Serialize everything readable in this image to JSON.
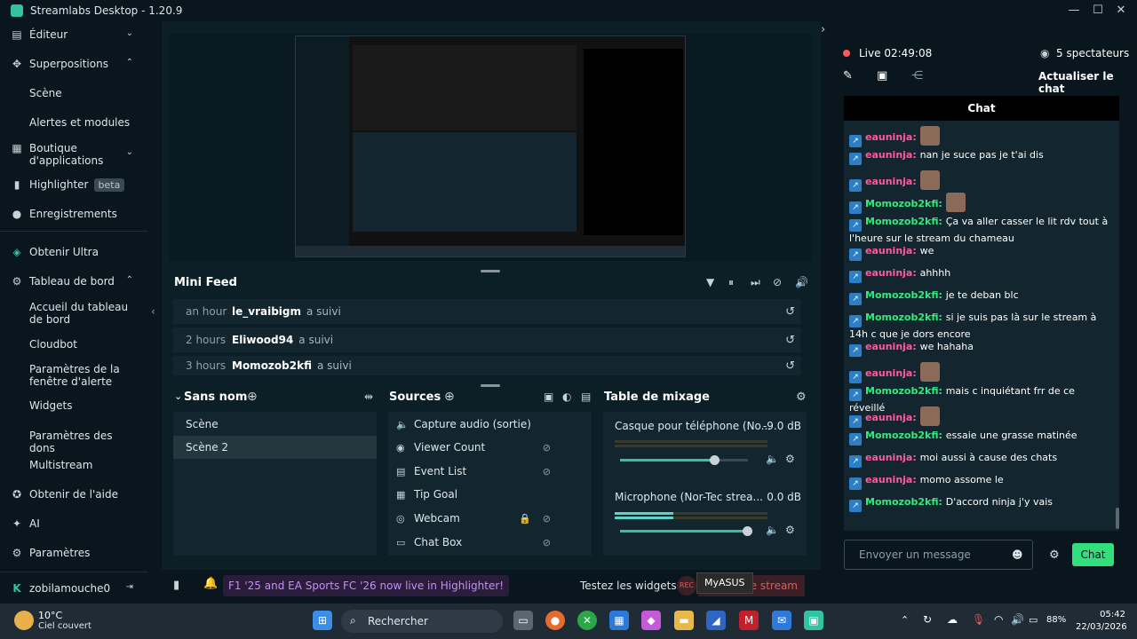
{
  "window": {
    "title": "Streamlabs Desktop - 1.20.9",
    "accent": "#31c3a2"
  },
  "sidebar": {
    "editor": "Éditeur",
    "overlays": "Superpositions",
    "overlays_sub": [
      "Scène",
      "Alertes et modules"
    ],
    "app_store": "Boutique d'applications",
    "highlighter": "Highlighter",
    "highlighter_badge": "beta",
    "recordings": "Enregistrements",
    "ultra": "Obtenir Ultra",
    "dashboard": "Tableau de bord",
    "dashboard_sub": [
      "Accueil du tableau de bord",
      "Cloudbot",
      "Paramètres de la fenêtre d'alerte",
      "Widgets",
      "Paramètres des dons",
      "Multistream"
    ],
    "help": "Obtenir de l'aide",
    "ai": "AI",
    "settings": "Paramètres",
    "user": "zobilamouche0"
  },
  "minifeed": {
    "title": "Mini Feed",
    "rows": [
      {
        "time": "an hour",
        "name": "le_vraibigm",
        "action": "a suivi"
      },
      {
        "time": "2 hours",
        "name": "Eliwood94",
        "action": "a suivi"
      },
      {
        "time": "3 hours",
        "name": "Momozob2kfi",
        "action": "a suivi"
      }
    ]
  },
  "scenes": {
    "title": "Sans nom",
    "items": [
      "Scène",
      "Scène 2"
    ]
  },
  "sources": {
    "title": "Sources",
    "items": [
      {
        "label": "Capture audio (sortie)",
        "icon": "speaker-icon"
      },
      {
        "label": "Viewer Count",
        "icon": "eye-icon"
      },
      {
        "label": "Event List",
        "icon": "list-icon"
      },
      {
        "label": "Tip Goal",
        "icon": "calendar-icon"
      },
      {
        "label": "Webcam",
        "icon": "webcam-icon"
      },
      {
        "label": "Chat Box",
        "icon": "chat-icon"
      }
    ]
  },
  "mixer": {
    "title": "Table de mixage",
    "channels": [
      {
        "label": "Casque pour téléphone (No...",
        "db": "-9.0 dB",
        "level": 0.74
      },
      {
        "label": "Microphone (Nor-Tec strea...",
        "db": "0.0 dB",
        "level": 1.0
      }
    ]
  },
  "bottombar": {
    "promo": "F1 '25 and EA Sports FC '26 now live in Highlighter!",
    "test_widgets": "Testez les widgets",
    "tooltip": "MyASUS",
    "end_stream": "r le stream"
  },
  "live": {
    "status": "Live",
    "time": "02:49:08",
    "viewers": "5 spectateurs",
    "refresh": "Actualiser le chat"
  },
  "chat": {
    "title": "Chat",
    "input_placeholder": "Envoyer un message",
    "send": "Chat",
    "messages": [
      {
        "user": "eauninja",
        "text": "",
        "emote": true,
        "type": "u1"
      },
      {
        "user": "eauninja",
        "text": "nan je suce pas je t'ai dis",
        "emote": false,
        "type": "u1"
      },
      {
        "user": "eauninja",
        "text": "",
        "emote": true,
        "type": "u1"
      },
      {
        "user": "Momozob2kfi",
        "text": "",
        "emote": true,
        "type": "u2"
      },
      {
        "user": "Momozob2kfi",
        "text": "Ça va aller casser le lit rdv tout à l'heure sur le stream du chameau",
        "emote": false,
        "type": "u2"
      },
      {
        "user": "eauninja",
        "text": "we",
        "emote": false,
        "type": "u1"
      },
      {
        "user": "eauninja",
        "text": "ahhhh",
        "emote": false,
        "type": "u1"
      },
      {
        "user": "Momozob2kfi",
        "text": "je te deban blc",
        "emote": false,
        "type": "u2"
      },
      {
        "user": "Momozob2kfi",
        "text": "si je suis pas là sur le stream à 14h c que je dors encore",
        "emote": false,
        "type": "u2"
      },
      {
        "user": "eauninja",
        "text": "we hahaha",
        "emote": false,
        "type": "u1"
      },
      {
        "user": "eauninja",
        "text": "",
        "emote": true,
        "type": "u1"
      },
      {
        "user": "Momozob2kfi",
        "text": "mais c inquiétant frr de ce réveillé",
        "emote": false,
        "type": "u2"
      },
      {
        "user": "eauninja",
        "text": "",
        "emote": true,
        "type": "u1"
      },
      {
        "user": "Momozob2kfi",
        "text": "essaie une grasse matinée",
        "emote": false,
        "type": "u2"
      },
      {
        "user": "eauninja",
        "text": "moi aussi à cause des chats",
        "emote": false,
        "type": "u1"
      },
      {
        "user": "eauninja",
        "text": "momo assome le",
        "emote": false,
        "type": "u1"
      },
      {
        "user": "Momozob2kfi",
        "text": "D'accord ninja j'y vais",
        "emote": false,
        "type": "u2"
      }
    ]
  },
  "taskbar": {
    "weather_temp": "10°C",
    "weather_desc": "Ciel couvert",
    "search": "Rechercher",
    "battery": "88%",
    "time": "05:42",
    "date": "22/03/2026"
  }
}
